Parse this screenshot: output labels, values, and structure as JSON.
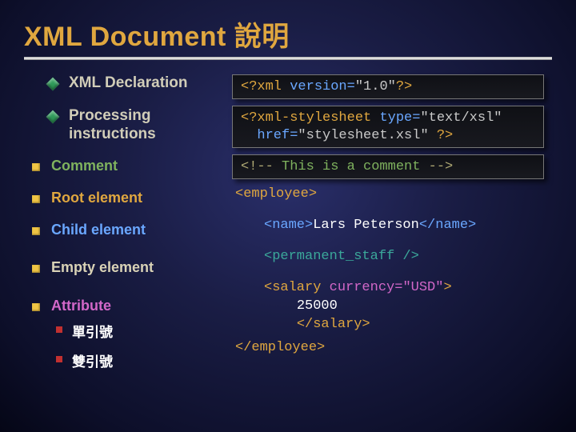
{
  "title": "XML Document 說明",
  "left": {
    "decl": "XML Declaration",
    "pi": "Processing instructions",
    "comment": "Comment",
    "root": "Root element",
    "child": "Child element",
    "empty": "Empty element",
    "attr": "Attribute",
    "sub_single": "單引號",
    "sub_double": "雙引號"
  },
  "colors": {
    "comment_label": "#7fb25e",
    "root_label": "#e0a73f",
    "child_label": "#6aa7ff",
    "attr_label": "#d267c8"
  },
  "code": {
    "decl_open": "<?",
    "decl_xml": "xml",
    "decl_ver_attr": "version=",
    "decl_ver_val": "\"1.0\"",
    "decl_close": "?>",
    "pi_open": "<?",
    "pi_name": "xml-stylesheet",
    "pi_type_attr": "type=",
    "pi_type_val": "\"text/xsl\"",
    "pi_href_attr": "href=",
    "pi_href_val": "\"stylesheet.xsl\"",
    "pi_close": "?>",
    "comment_open": "<!--",
    "comment_text": " This is a comment ",
    "comment_close": "-->",
    "root_open_lt": "<",
    "root_name": "employee",
    "root_open_gt": ">",
    "child_open_lt": "<",
    "child_name": "name",
    "child_open_gt": ">",
    "child_text": "Lars Peterson",
    "child_close": "</name>",
    "empty_open": "<",
    "empty_name": "permanent_staff",
    "empty_close": " />",
    "sal_open_lt": "<",
    "sal_name": "salary",
    "sal_attr": " currency=",
    "sal_attr_val": "\"USD\"",
    "sal_open_gt": ">",
    "sal_text": "25000",
    "sal_close": "</salary>",
    "root_close": "</employee>"
  }
}
